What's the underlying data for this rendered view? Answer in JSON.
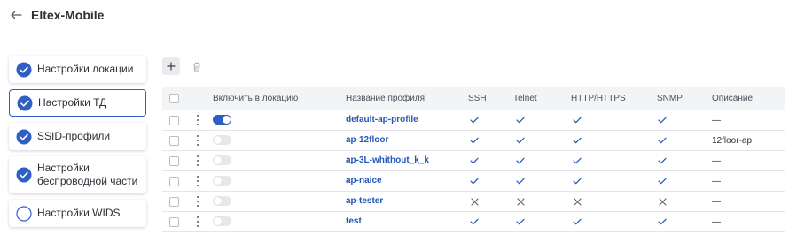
{
  "header": {
    "title": "Eltex-Mobile"
  },
  "steps": [
    {
      "label": "Настройки локации",
      "done": true,
      "active": false
    },
    {
      "label": "Настройки ТД",
      "done": true,
      "active": true
    },
    {
      "label": "SSID-профили",
      "done": true,
      "active": false
    },
    {
      "label": "Настройки беспроводной части",
      "done": true,
      "active": false
    },
    {
      "label": "Настройки WIDS",
      "done": false,
      "active": false
    }
  ],
  "table": {
    "columns": {
      "enable": "Включить в локацию",
      "name": "Название профиля",
      "ssh": "SSH",
      "telnet": "Telnet",
      "http": "HTTP/HTTPS",
      "snmp": "SNMP",
      "desc": "Описание"
    },
    "rows": [
      {
        "enabled": true,
        "name": "default-ap-profile",
        "ssh": true,
        "telnet": true,
        "http": true,
        "snmp": true,
        "desc": "—"
      },
      {
        "enabled": false,
        "name": "ap-12floor",
        "ssh": true,
        "telnet": true,
        "http": true,
        "snmp": true,
        "desc": "12floor-ap"
      },
      {
        "enabled": false,
        "name": "ap-3L-whithout_k_k",
        "ssh": true,
        "telnet": true,
        "http": true,
        "snmp": true,
        "desc": "—"
      },
      {
        "enabled": false,
        "name": "ap-naice",
        "ssh": true,
        "telnet": true,
        "http": true,
        "snmp": true,
        "desc": "—"
      },
      {
        "enabled": false,
        "name": "ap-tester",
        "ssh": false,
        "telnet": false,
        "http": false,
        "snmp": false,
        "desc": "—"
      },
      {
        "enabled": false,
        "name": "test",
        "ssh": true,
        "telnet": true,
        "http": true,
        "snmp": true,
        "desc": "—"
      }
    ]
  },
  "colors": {
    "accent": "#2f5ec4",
    "link": "#2556b8",
    "header_bg": "#f3f4f6"
  }
}
